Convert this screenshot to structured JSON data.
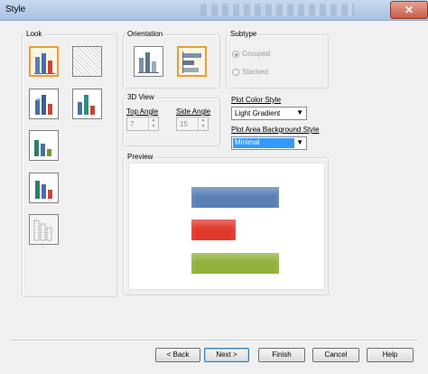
{
  "window": {
    "title": "Style",
    "close_glyph": "✕"
  },
  "look": {
    "label": "Look",
    "buttons": [
      {
        "name": "look-gradient-bar",
        "icon": "gradient-bar-chart-icon",
        "selected": true
      },
      {
        "name": "look-empty-pattern",
        "icon": "empty-pattern-icon",
        "selected": false
      },
      {
        "name": "look-3d-bar",
        "icon": "3d-bar-chart-icon",
        "selected": false
      },
      {
        "name": "look-3d-bar-teal",
        "icon": "3d-bar-chart-teal-icon",
        "selected": false
      },
      {
        "name": "look-3d-bar-green",
        "icon": "3d-bar-chart-green-icon",
        "selected": false
      },
      {
        "name": "look-3d-bar-perspective",
        "icon": "3d-bar-perspective-icon",
        "selected": false
      },
      {
        "name": "look-outline-bar",
        "icon": "outline-bar-chart-icon",
        "selected": false
      }
    ]
  },
  "orientation": {
    "label": "Orientation",
    "buttons": [
      {
        "name": "vertical",
        "icon": "vertical-bar-chart-icon",
        "selected": false
      },
      {
        "name": "horizontal",
        "icon": "horizontal-bar-chart-icon",
        "selected": true
      }
    ]
  },
  "subtype": {
    "label": "Subtype",
    "options": [
      {
        "label": "Grouped",
        "checked": true
      },
      {
        "label": "Stacked",
        "checked": false
      }
    ]
  },
  "view3d": {
    "label": "3D View",
    "top_angle_label": "Top Angle",
    "top_angle_value": "7",
    "side_angle_label": "Side Angle",
    "side_angle_value": "15"
  },
  "plot_color": {
    "label": "Plot Color Style",
    "value": "Light Gradient"
  },
  "plot_area_bg": {
    "label": "Plot Area Background Style",
    "value": "Minimal"
  },
  "preview": {
    "label": "Preview",
    "bars": [
      {
        "color": "#5b7fb5",
        "relative_length": 1.0
      },
      {
        "color": "#e0392b",
        "relative_length": 0.5
      },
      {
        "color": "#8fb33a",
        "relative_length": 1.0
      }
    ]
  },
  "footer": {
    "back": "< Back",
    "next": "Next >",
    "finish": "Finish",
    "cancel": "Cancel",
    "help": "Help"
  }
}
